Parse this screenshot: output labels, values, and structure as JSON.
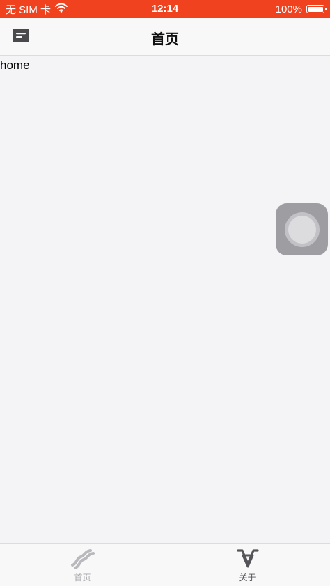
{
  "status_bar": {
    "carrier": "无 SIM 卡",
    "time": "12:14",
    "battery": "100%",
    "icons": [
      "wifi-icon",
      "battery-icon"
    ]
  },
  "nav": {
    "title": "首页",
    "left_icon": "menu-icon"
  },
  "content": {
    "text": "home"
  },
  "floating_button": {
    "icon": "assistive-touch-icon"
  },
  "tabs": [
    {
      "label": "首页",
      "icon": "home-wave-icon",
      "active": false
    },
    {
      "label": "关于",
      "icon": "about-v-icon",
      "active": true
    }
  ],
  "colors": {
    "status_bar_bg": "#f0421e",
    "nav_bg": "#f8f8f9",
    "content_bg": "#f4f4f6",
    "tab_inactive": "#a8a8ad",
    "tab_active": "#555559"
  }
}
